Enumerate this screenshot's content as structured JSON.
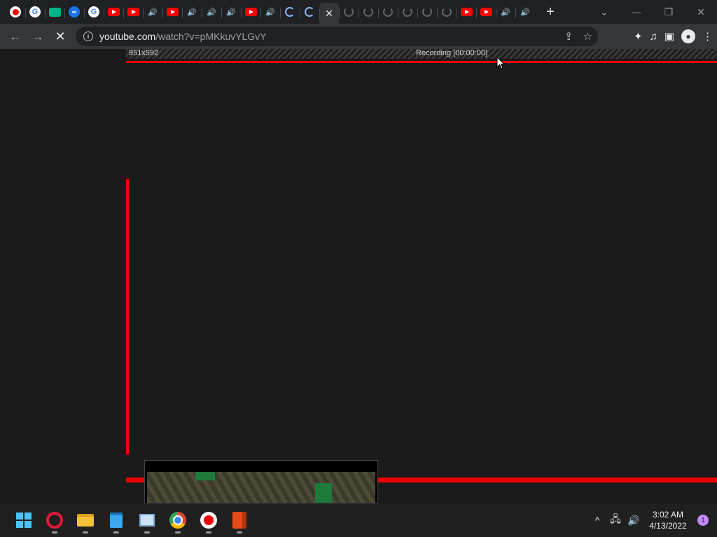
{
  "browser": {
    "tabs": [
      {
        "icon": "record-icon"
      },
      {
        "icon": "google-icon",
        "glyph": "G"
      },
      {
        "icon": "teal-app-icon"
      },
      {
        "icon": "loop-icon",
        "glyph": "∞"
      },
      {
        "icon": "google-icon",
        "glyph": "G"
      },
      {
        "icon": "youtube-icon"
      },
      {
        "icon": "youtube-icon"
      },
      {
        "icon": "speaker-icon",
        "glyph": "🔊"
      },
      {
        "icon": "youtube-icon"
      },
      {
        "icon": "speaker-icon",
        "glyph": "🔊"
      },
      {
        "icon": "speaker-icon",
        "glyph": "🔊"
      },
      {
        "icon": "speaker-icon",
        "glyph": "🔊"
      },
      {
        "icon": "youtube-icon"
      },
      {
        "icon": "speaker-icon",
        "glyph": "🔊"
      },
      {
        "icon": "loading-spinner-icon"
      },
      {
        "icon": "loading-spinner-icon"
      },
      {
        "icon": "close-icon",
        "glyph": "✕",
        "active": true
      },
      {
        "icon": "loading-spinner-icon"
      },
      {
        "icon": "loading-spinner-icon"
      },
      {
        "icon": "loading-spinner-icon"
      },
      {
        "icon": "loading-spinner-icon"
      },
      {
        "icon": "loading-spinner-icon"
      },
      {
        "icon": "loading-spinner-icon"
      },
      {
        "icon": "youtube-icon"
      },
      {
        "icon": "youtube-icon"
      },
      {
        "icon": "speaker-icon",
        "glyph": "🔊"
      },
      {
        "icon": "speaker-icon",
        "glyph": "🔊"
      }
    ],
    "new_tab_glyph": "+",
    "window_controls": {
      "tab_search": "⌄",
      "minimize": "—",
      "restore": "❐",
      "close": "✕"
    },
    "nav": {
      "back": "←",
      "forward": "→",
      "stop": "✕"
    },
    "omnibox": {
      "info_glyph": "i",
      "url_host": "youtube.com",
      "url_path": "/watch?v=pMKkuvYLGvY",
      "share_glyph": "⇪",
      "bookmark_glyph": "☆"
    },
    "toolbar_right": {
      "extensions": "✦",
      "media": "♫",
      "side_panel": "▣",
      "profile": "●",
      "menu": "⋮"
    }
  },
  "recording": {
    "dimensions": "951x592",
    "status": "Recording [00:00:00]",
    "accent": "#ee0000"
  },
  "taskbar": {
    "apps": [
      "start-icon",
      "opera-icon",
      "file-explorer-icon",
      "notepad-icon",
      "photos-icon",
      "chrome-icon",
      "recorder-icon",
      "office-icon"
    ],
    "tray": {
      "chevron": "^",
      "network": "🖧",
      "volume": "🔊"
    },
    "time": "3:02 AM",
    "date": "4/13/2022",
    "notification_count": "1"
  }
}
